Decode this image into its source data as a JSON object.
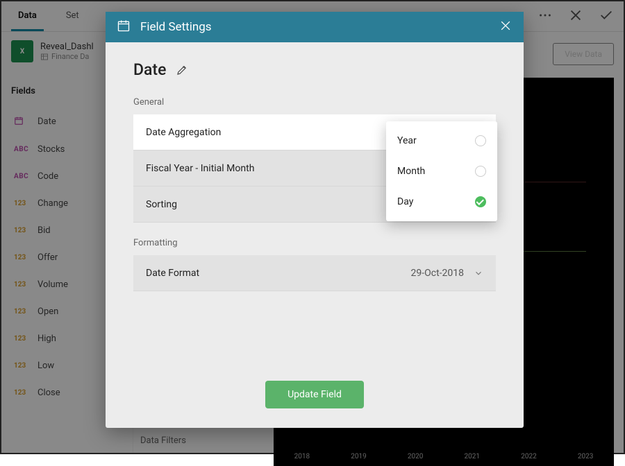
{
  "tabs": {
    "data": "Data",
    "settings_partial": "Set"
  },
  "file": {
    "name": "Reveal_Dashl",
    "sub": "Finance Da"
  },
  "sidebar": {
    "header": "Fields",
    "items": [
      {
        "type": "date",
        "tag": "📅",
        "label": "Date"
      },
      {
        "type": "abc",
        "tag": "ABC",
        "label": "Stocks"
      },
      {
        "type": "abc",
        "tag": "ABC",
        "label": "Code"
      },
      {
        "type": "num",
        "tag": "123",
        "label": "Change"
      },
      {
        "type": "num",
        "tag": "123",
        "label": "Bid"
      },
      {
        "type": "num",
        "tag": "123",
        "label": "Offer"
      },
      {
        "type": "num",
        "tag": "123",
        "label": "Volume"
      },
      {
        "type": "num",
        "tag": "123",
        "label": "Open"
      },
      {
        "type": "num",
        "tag": "123",
        "label": "High"
      },
      {
        "type": "num",
        "tag": "123",
        "label": "Low"
      },
      {
        "type": "num",
        "tag": "123",
        "label": "Close"
      }
    ]
  },
  "right": {
    "view_data": "View Data",
    "xaxis": [
      "2018",
      "2019",
      "2020",
      "2021",
      "2022",
      "2023"
    ]
  },
  "data_filters_label": "Data Filters",
  "modal": {
    "header": "Field Settings",
    "field_name": "Date",
    "section_general": "General",
    "rows": {
      "aggregation": "Date Aggregation",
      "fiscal": "Fiscal Year - Initial Month",
      "sorting": "Sorting"
    },
    "section_formatting": "Formatting",
    "date_format_label": "Date Format",
    "date_format_value": "29-Oct-2018",
    "update_btn": "Update Field"
  },
  "aggregation_options": {
    "year": "Year",
    "month": "Month",
    "day": "Day",
    "selected": "day"
  }
}
